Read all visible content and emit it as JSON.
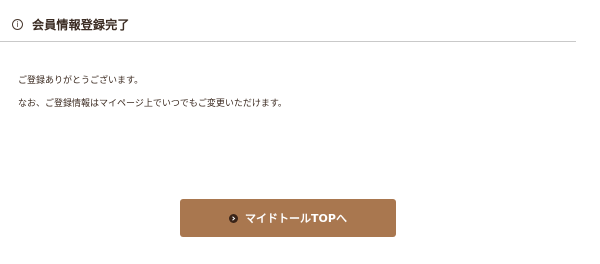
{
  "header": {
    "icon": "info-icon",
    "title": "会員情報登録完了"
  },
  "message": {
    "line1": "ご登録ありがとうございます。",
    "line2": "なお、ご登録情報はマイページ上でいつでもご変更いただけます。"
  },
  "button": {
    "icon": "chevron-right-icon",
    "label": "マイドトールTOPへ"
  },
  "colors": {
    "button_bg": "#a9774f",
    "icon_bg": "#3a2418",
    "text": "#3b2a20",
    "divider": "#c9c9c9"
  }
}
